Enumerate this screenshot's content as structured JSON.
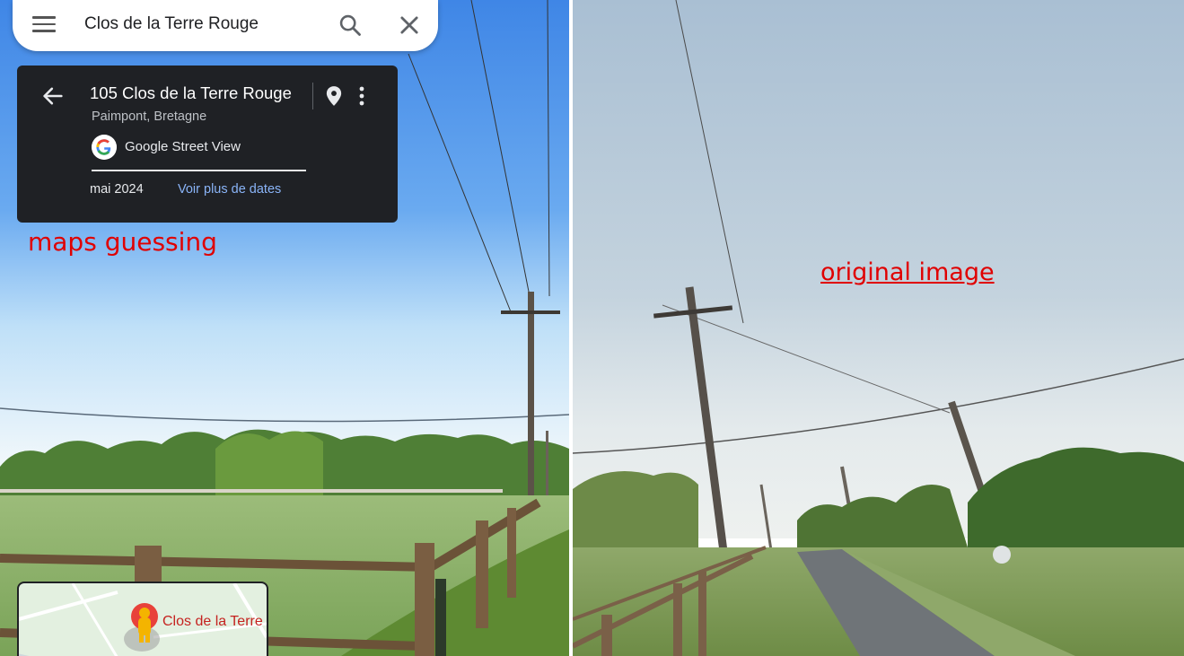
{
  "search": {
    "query": "Clos de la Terre Rouge",
    "menu_icon": "hamburger-menu-icon",
    "search_icon": "search-icon",
    "clear_icon": "close-icon"
  },
  "info_card": {
    "address": "105 Clos de la Terre Rouge",
    "locality": "Paimpont, Bretagne",
    "source": "Google Street View",
    "date": "mai 2024",
    "more_dates": "Voir plus de dates",
    "back_icon": "arrow-back-icon",
    "pin_icon": "map-pin-icon",
    "more_icon": "more-vert-icon"
  },
  "captions": {
    "left": "maps guessing",
    "right": "original image"
  },
  "mini_map": {
    "label": "Clos de la Terre Rouge",
    "marker_icon": "pegman-icon"
  },
  "colors": {
    "caption": "#e00000",
    "card_bg": "#1f2125",
    "link": "#8ab4f8"
  }
}
